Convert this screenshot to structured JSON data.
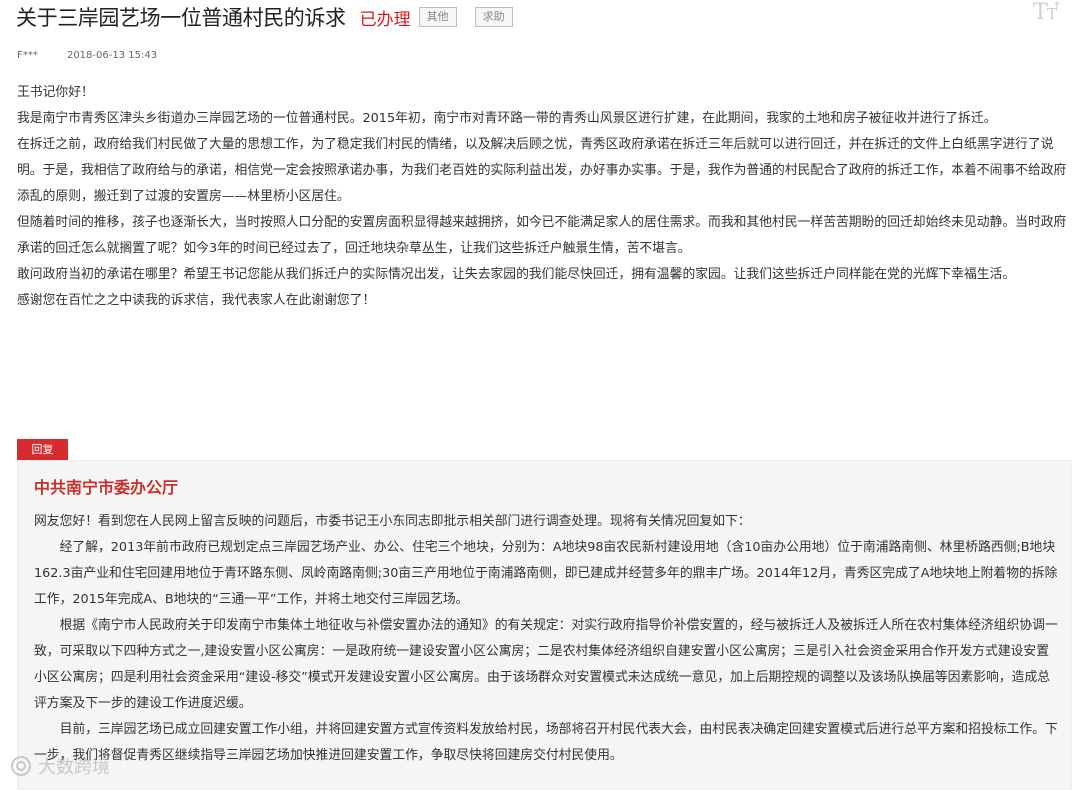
{
  "post": {
    "title": "关于三岸园艺场一位普通村民的诉求",
    "status": "已办理",
    "tags": [
      "其他",
      "求助"
    ],
    "author": "F***",
    "date": "2018-06-13 15:43"
  },
  "letter": {
    "paragraphs": [
      "王书记你好！",
      "我是南宁市青秀区津头乡街道办三岸园艺场的一位普通村民。2015年初，南宁市对青环路一带的青秀山风景区进行扩建，在此期间，我家的土地和房子被征收并进行了拆迁。",
      "在拆迁之前，政府给我们村民做了大量的思想工作，为了稳定我们村民的情绪，以及解决后顾之忧，青秀区政府承诺在拆迁三年后就可以进行回迁，并在拆迁的文件上白纸黑字进行了说明。于是，我相信了政府给与的承诺，相信党一定会按照承诺办事，为我们老百姓的实际利益出发，办好事办实事。于是，我作为普通的村民配合了政府的拆迁工作，本着不闹事不给政府添乱的原则，搬迁到了过渡的安置房——林里桥小区居住。",
      "但随着时间的推移，孩子也逐渐长大，当时按照人口分配的安置房面积显得越来越拥挤，如今已不能满足家人的居住需求。而我和其他村民一样苦苦期盼的回迁却始终未见动静。当时政府承诺的回迁怎么就搁置了呢？如今3年的时间已经过去了，回迁地块杂草丛生，让我们这些拆迁户触景生情，苦不堪言。",
      "敢问政府当初的承诺在哪里？希望王书记您能从我们拆迁户的实际情况出发，让失去家园的我们能尽快回迁，拥有温馨的家园。让我们这些拆迁户同样能在党的光辉下幸福生活。",
      "感谢您在百忙之之中读我的诉求信，我代表家人在此谢谢您了！"
    ]
  },
  "reply": {
    "badge": "回复",
    "org": "中共南宁市委办公厅",
    "greeting": "网友您好！看到您在人民网上留言反映的问题后，市委书记王小东同志即批示相关部门进行调查处理。现将有关情况回复如下：",
    "paragraphs": [
      "经了解，2013年前市政府已规划定点三岸园艺场产业、办公、住宅三个地块，分别为：A地块98亩农民新村建设用地（含10亩办公用地）位于南浦路南侧、林里桥路西侧;B地块162.3亩产业和住宅回建用地位于青环路东侧、凤岭南路南侧;30亩三产用地位于南浦路南侧，即已建成并经营多年的鼎丰广场。2014年12月，青秀区完成了A地块地上附着物的拆除工作，2015年完成A、B地块的“三通一平”工作，并将土地交付三岸园艺场。",
      "根据《南宁市人民政府关于印发南宁市集体土地征收与补偿安置办法的通知》的有关规定：对实行政府指导价补偿安置的，经与被拆迁人及被拆迁人所在农村集体经济组织协调一致，可采取以下四种方式之一,建设安置小区公寓房：一是政府统一建设安置小区公寓房；二是农村集体经济组织自建安置小区公寓房；三是引入社会资金采用合作开发方式建设安置小区公寓房；四是利用社会资金采用“建设-移交”模式开发建设安置小区公寓房。由于该场群众对安置模式未达成统一意见，加上后期控规的调整以及该场队换届等因素影响，造成总评方案及下一步的建设工作进度迟缓。",
      "目前，三岸园艺场已成立回建安置工作小组，并将回建安置方式宣传资料发放给村民，场部将召开村民代表大会，由村民表决确定回建安置模式后进行总平方案和招投标工作。下一步，我们将督促青秀区继续指导三岸园艺场加快推进回建安置工作，争取尽快将回建房交付村民使用。"
    ]
  },
  "watermark": {
    "text": "大数跨境",
    "icon": "watermark-logo-icon"
  },
  "toolbar": {
    "font_size_icon": "font-size-icon"
  }
}
